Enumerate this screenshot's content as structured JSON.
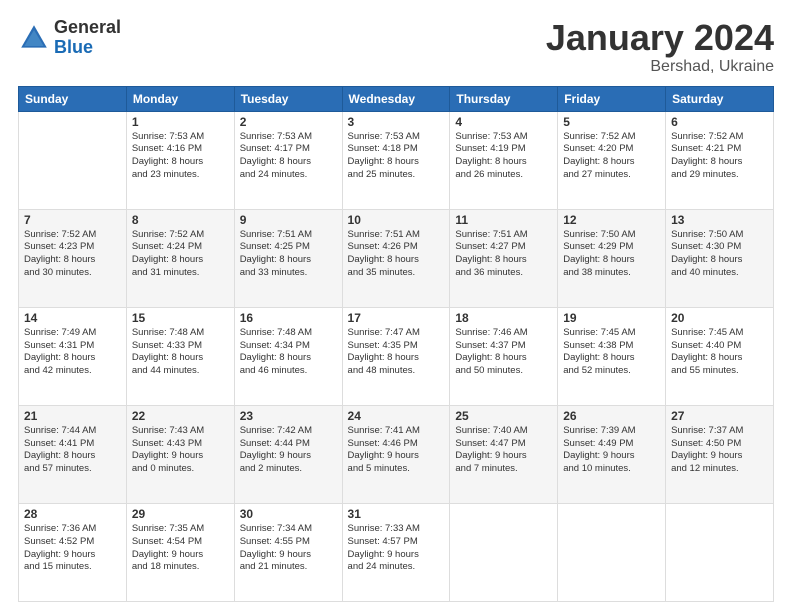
{
  "logo": {
    "general": "General",
    "blue": "Blue"
  },
  "header": {
    "month": "January 2024",
    "location": "Bershad, Ukraine"
  },
  "weekdays": [
    "Sunday",
    "Monday",
    "Tuesday",
    "Wednesday",
    "Thursday",
    "Friday",
    "Saturday"
  ],
  "weeks": [
    [
      {
        "day": "",
        "info": ""
      },
      {
        "day": "1",
        "info": "Sunrise: 7:53 AM\nSunset: 4:16 PM\nDaylight: 8 hours\nand 23 minutes."
      },
      {
        "day": "2",
        "info": "Sunrise: 7:53 AM\nSunset: 4:17 PM\nDaylight: 8 hours\nand 24 minutes."
      },
      {
        "day": "3",
        "info": "Sunrise: 7:53 AM\nSunset: 4:18 PM\nDaylight: 8 hours\nand 25 minutes."
      },
      {
        "day": "4",
        "info": "Sunrise: 7:53 AM\nSunset: 4:19 PM\nDaylight: 8 hours\nand 26 minutes."
      },
      {
        "day": "5",
        "info": "Sunrise: 7:52 AM\nSunset: 4:20 PM\nDaylight: 8 hours\nand 27 minutes."
      },
      {
        "day": "6",
        "info": "Sunrise: 7:52 AM\nSunset: 4:21 PM\nDaylight: 8 hours\nand 29 minutes."
      }
    ],
    [
      {
        "day": "7",
        "info": "Sunrise: 7:52 AM\nSunset: 4:23 PM\nDaylight: 8 hours\nand 30 minutes."
      },
      {
        "day": "8",
        "info": "Sunrise: 7:52 AM\nSunset: 4:24 PM\nDaylight: 8 hours\nand 31 minutes."
      },
      {
        "day": "9",
        "info": "Sunrise: 7:51 AM\nSunset: 4:25 PM\nDaylight: 8 hours\nand 33 minutes."
      },
      {
        "day": "10",
        "info": "Sunrise: 7:51 AM\nSunset: 4:26 PM\nDaylight: 8 hours\nand 35 minutes."
      },
      {
        "day": "11",
        "info": "Sunrise: 7:51 AM\nSunset: 4:27 PM\nDaylight: 8 hours\nand 36 minutes."
      },
      {
        "day": "12",
        "info": "Sunrise: 7:50 AM\nSunset: 4:29 PM\nDaylight: 8 hours\nand 38 minutes."
      },
      {
        "day": "13",
        "info": "Sunrise: 7:50 AM\nSunset: 4:30 PM\nDaylight: 8 hours\nand 40 minutes."
      }
    ],
    [
      {
        "day": "14",
        "info": "Sunrise: 7:49 AM\nSunset: 4:31 PM\nDaylight: 8 hours\nand 42 minutes."
      },
      {
        "day": "15",
        "info": "Sunrise: 7:48 AM\nSunset: 4:33 PM\nDaylight: 8 hours\nand 44 minutes."
      },
      {
        "day": "16",
        "info": "Sunrise: 7:48 AM\nSunset: 4:34 PM\nDaylight: 8 hours\nand 46 minutes."
      },
      {
        "day": "17",
        "info": "Sunrise: 7:47 AM\nSunset: 4:35 PM\nDaylight: 8 hours\nand 48 minutes."
      },
      {
        "day": "18",
        "info": "Sunrise: 7:46 AM\nSunset: 4:37 PM\nDaylight: 8 hours\nand 50 minutes."
      },
      {
        "day": "19",
        "info": "Sunrise: 7:45 AM\nSunset: 4:38 PM\nDaylight: 8 hours\nand 52 minutes."
      },
      {
        "day": "20",
        "info": "Sunrise: 7:45 AM\nSunset: 4:40 PM\nDaylight: 8 hours\nand 55 minutes."
      }
    ],
    [
      {
        "day": "21",
        "info": "Sunrise: 7:44 AM\nSunset: 4:41 PM\nDaylight: 8 hours\nand 57 minutes."
      },
      {
        "day": "22",
        "info": "Sunrise: 7:43 AM\nSunset: 4:43 PM\nDaylight: 9 hours\nand 0 minutes."
      },
      {
        "day": "23",
        "info": "Sunrise: 7:42 AM\nSunset: 4:44 PM\nDaylight: 9 hours\nand 2 minutes."
      },
      {
        "day": "24",
        "info": "Sunrise: 7:41 AM\nSunset: 4:46 PM\nDaylight: 9 hours\nand 5 minutes."
      },
      {
        "day": "25",
        "info": "Sunrise: 7:40 AM\nSunset: 4:47 PM\nDaylight: 9 hours\nand 7 minutes."
      },
      {
        "day": "26",
        "info": "Sunrise: 7:39 AM\nSunset: 4:49 PM\nDaylight: 9 hours\nand 10 minutes."
      },
      {
        "day": "27",
        "info": "Sunrise: 7:37 AM\nSunset: 4:50 PM\nDaylight: 9 hours\nand 12 minutes."
      }
    ],
    [
      {
        "day": "28",
        "info": "Sunrise: 7:36 AM\nSunset: 4:52 PM\nDaylight: 9 hours\nand 15 minutes."
      },
      {
        "day": "29",
        "info": "Sunrise: 7:35 AM\nSunset: 4:54 PM\nDaylight: 9 hours\nand 18 minutes."
      },
      {
        "day": "30",
        "info": "Sunrise: 7:34 AM\nSunset: 4:55 PM\nDaylight: 9 hours\nand 21 minutes."
      },
      {
        "day": "31",
        "info": "Sunrise: 7:33 AM\nSunset: 4:57 PM\nDaylight: 9 hours\nand 24 minutes."
      },
      {
        "day": "",
        "info": ""
      },
      {
        "day": "",
        "info": ""
      },
      {
        "day": "",
        "info": ""
      }
    ]
  ]
}
